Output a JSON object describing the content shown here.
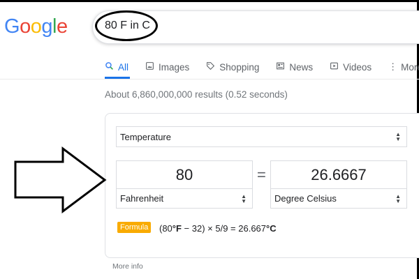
{
  "logo": {
    "letters": [
      "G",
      "o",
      "o",
      "g",
      "l",
      "e"
    ],
    "colors": [
      "#4285F4",
      "#EA4335",
      "#FBBC05",
      "#4285F4",
      "#34A853",
      "#EA4335"
    ]
  },
  "search": {
    "query": "80 F in C"
  },
  "tabs": [
    {
      "label": "All",
      "icon": "search-icon",
      "active": true
    },
    {
      "label": "Images",
      "icon": "image-icon"
    },
    {
      "label": "Shopping",
      "icon": "tag-icon"
    },
    {
      "label": "News",
      "icon": "news-icon"
    },
    {
      "label": "Videos",
      "icon": "play-icon"
    },
    {
      "label": "More",
      "icon": "more-vert-icon"
    }
  ],
  "results": {
    "stats": "About 6,860,000,000 results (0.52 seconds)"
  },
  "converter": {
    "category": "Temperature",
    "from": {
      "value": "80",
      "unit": "Fahrenheit"
    },
    "equals": "=",
    "to": {
      "value": "26.6667",
      "unit": "Degree Celsius"
    },
    "formula_label": "Formula",
    "formula": {
      "open": "(80",
      "from_unit": "°F",
      "middle": " − 32) × 5/9 = 26.667",
      "to_unit": "°C"
    },
    "more_info": "More info"
  },
  "colors": {
    "accent": "#1a73e8",
    "formula_badge": "#f9ab00",
    "annotation": "#000000"
  }
}
